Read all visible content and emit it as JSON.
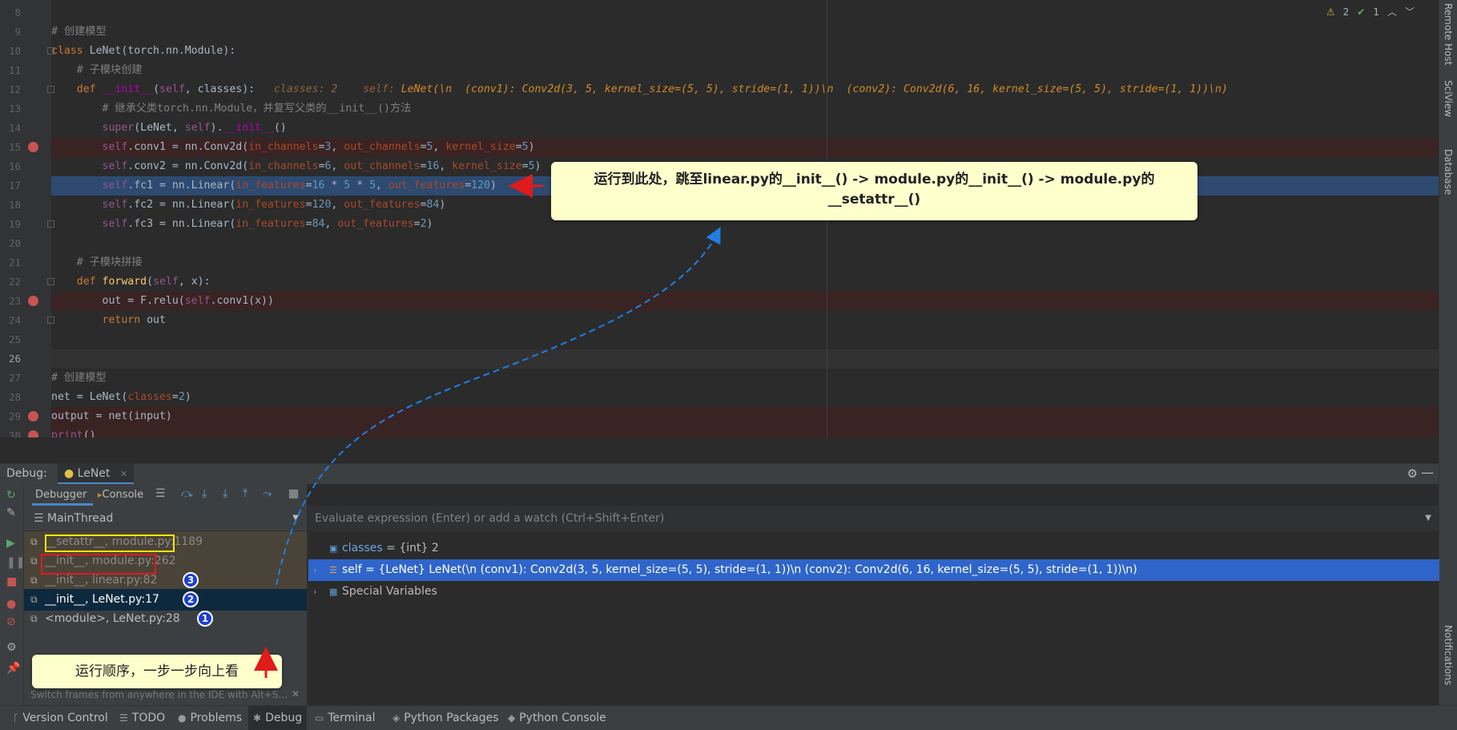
{
  "editor": {
    "lines": [
      {
        "n": "8",
        "parts": []
      },
      {
        "n": "9",
        "parts": [
          {
            "c": "cm",
            "t": "# 创建模型"
          }
        ]
      },
      {
        "n": "10",
        "parts": [
          {
            "c": "kw",
            "t": "class "
          },
          {
            "c": "",
            "t": "LeNet(torch.nn.Module):"
          }
        ]
      },
      {
        "n": "11",
        "parts": [
          {
            "c": "cm",
            "t": "    # 子模块创建"
          }
        ]
      },
      {
        "n": "12",
        "parts": [
          {
            "c": "kw",
            "t": "    def "
          },
          {
            "c": "mag",
            "t": "__init__"
          },
          {
            "c": "",
            "t": "("
          },
          {
            "c": "self",
            "t": "self"
          },
          {
            "c": "",
            "t": ", classes):   "
          },
          {
            "c": "dbg",
            "t": "classes: 2    self: "
          },
          {
            "c": "dbgv",
            "t": "LeNet(\\n  (conv1): Conv2d(3, 5, kernel_size=(5, 5), stride=(1, 1))\\n  (conv2): Conv2d(6, 16, kernel_size=(5, 5), stride=(1, 1))\\n)"
          }
        ]
      },
      {
        "n": "13",
        "parts": [
          {
            "c": "cm",
            "t": "        # 继承父类torch.nn.Module，并复写父类的__init__()方法"
          }
        ]
      },
      {
        "n": "14",
        "parts": [
          {
            "c": "self",
            "t": "        super"
          },
          {
            "c": "",
            "t": "(LeNet, "
          },
          {
            "c": "self",
            "t": "self"
          },
          {
            "c": "",
            "t": ")."
          },
          {
            "c": "mag",
            "t": "__init__"
          },
          {
            "c": "",
            "t": "()"
          }
        ]
      },
      {
        "n": "15",
        "parts": [
          {
            "c": "self",
            "t": "        self"
          },
          {
            "c": "",
            "t": ".conv1 = nn.Conv2d("
          },
          {
            "c": "prm",
            "t": "in_channels"
          },
          {
            "c": "",
            "t": "="
          },
          {
            "c": "num",
            "t": "3"
          },
          {
            "c": "",
            "t": ", "
          },
          {
            "c": "prm",
            "t": "out_channels"
          },
          {
            "c": "",
            "t": "="
          },
          {
            "c": "num",
            "t": "5"
          },
          {
            "c": "",
            "t": ", "
          },
          {
            "c": "prm",
            "t": "kernel_size"
          },
          {
            "c": "",
            "t": "="
          },
          {
            "c": "num",
            "t": "5"
          },
          {
            "c": "",
            "t": ")"
          }
        ]
      },
      {
        "n": "16",
        "parts": [
          {
            "c": "self",
            "t": "        self"
          },
          {
            "c": "",
            "t": ".conv2 = nn.Conv2d("
          },
          {
            "c": "prm",
            "t": "in_channels"
          },
          {
            "c": "",
            "t": "="
          },
          {
            "c": "num",
            "t": "6"
          },
          {
            "c": "",
            "t": ", "
          },
          {
            "c": "prm",
            "t": "out_channels"
          },
          {
            "c": "",
            "t": "="
          },
          {
            "c": "num",
            "t": "16"
          },
          {
            "c": "",
            "t": ", "
          },
          {
            "c": "prm",
            "t": "kernel_size"
          },
          {
            "c": "",
            "t": "="
          },
          {
            "c": "num",
            "t": "5"
          },
          {
            "c": "",
            "t": ")"
          }
        ]
      },
      {
        "n": "17",
        "parts": [
          {
            "c": "self",
            "t": "        self"
          },
          {
            "c": "",
            "t": ".fc1 = nn.Linear("
          },
          {
            "c": "prm",
            "t": "in_features"
          },
          {
            "c": "",
            "t": "="
          },
          {
            "c": "num",
            "t": "16"
          },
          {
            "c": "",
            "t": " * "
          },
          {
            "c": "num",
            "t": "5"
          },
          {
            "c": "",
            "t": " * "
          },
          {
            "c": "num",
            "t": "5"
          },
          {
            "c": "",
            "t": ", "
          },
          {
            "c": "prm",
            "t": "out_features"
          },
          {
            "c": "",
            "t": "="
          },
          {
            "c": "num",
            "t": "120"
          },
          {
            "c": "",
            "t": ")"
          }
        ]
      },
      {
        "n": "18",
        "parts": [
          {
            "c": "self",
            "t": "        self"
          },
          {
            "c": "",
            "t": ".fc2 = nn.Linear("
          },
          {
            "c": "prm",
            "t": "in_features"
          },
          {
            "c": "",
            "t": "="
          },
          {
            "c": "num",
            "t": "120"
          },
          {
            "c": "",
            "t": ", "
          },
          {
            "c": "prm",
            "t": "out_features"
          },
          {
            "c": "",
            "t": "="
          },
          {
            "c": "num",
            "t": "84"
          },
          {
            "c": "",
            "t": ")"
          }
        ]
      },
      {
        "n": "19",
        "parts": [
          {
            "c": "self",
            "t": "        self"
          },
          {
            "c": "",
            "t": ".fc3 = nn.Linear("
          },
          {
            "c": "prm",
            "t": "in_features"
          },
          {
            "c": "",
            "t": "="
          },
          {
            "c": "num",
            "t": "84"
          },
          {
            "c": "",
            "t": ", "
          },
          {
            "c": "prm",
            "t": "out_features"
          },
          {
            "c": "",
            "t": "="
          },
          {
            "c": "num",
            "t": "2"
          },
          {
            "c": "",
            "t": ")"
          }
        ]
      },
      {
        "n": "20",
        "parts": []
      },
      {
        "n": "21",
        "parts": [
          {
            "c": "cm",
            "t": "    # 子模块拼接"
          }
        ]
      },
      {
        "n": "22",
        "parts": [
          {
            "c": "kw",
            "t": "    def "
          },
          {
            "c": "fn",
            "t": "forward"
          },
          {
            "c": "",
            "t": "("
          },
          {
            "c": "self",
            "t": "self"
          },
          {
            "c": "",
            "t": ", x):"
          }
        ]
      },
      {
        "n": "23",
        "parts": [
          {
            "c": "",
            "t": "        out = F.relu("
          },
          {
            "c": "self",
            "t": "self"
          },
          {
            "c": "",
            "t": ".conv1(x))"
          }
        ]
      },
      {
        "n": "24",
        "parts": [
          {
            "c": "kw",
            "t": "        return "
          },
          {
            "c": "",
            "t": "out"
          }
        ]
      },
      {
        "n": "25",
        "parts": []
      },
      {
        "n": "26",
        "parts": []
      },
      {
        "n": "27",
        "parts": [
          {
            "c": "cm",
            "t": "# 创建模型"
          }
        ]
      },
      {
        "n": "28",
        "parts": [
          {
            "c": "",
            "t": "net = LeNet("
          },
          {
            "c": "prm",
            "t": "classes"
          },
          {
            "c": "",
            "t": "="
          },
          {
            "c": "num",
            "t": "2"
          },
          {
            "c": "",
            "t": ")"
          }
        ]
      },
      {
        "n": "29",
        "parts": [
          {
            "c": "",
            "t": "output = net(input)"
          }
        ]
      },
      {
        "n": "30",
        "parts": [
          {
            "c": "self",
            "t": "print"
          },
          {
            "c": "",
            "t": "()"
          }
        ]
      }
    ],
    "inspections": {
      "warnings": "2",
      "ok": "1"
    }
  },
  "callouts": {
    "step_note": "运行到此处，跳至linear.py的__init__() -> module.py的__init__() -> module.py的__setattr__()",
    "order_note": "运行顺序，一步一步向上看"
  },
  "right_strip": {
    "tabs": [
      "Remote Host",
      "SciView",
      "Database",
      "Notifications"
    ]
  },
  "debug": {
    "label": "Debug:",
    "run_tab": "LeNet",
    "subtabs": {
      "debugger": "Debugger",
      "console": "Console"
    },
    "thread": "MainThread",
    "frames": [
      {
        "text": "__setattr__, module.py:1189",
        "kind": "lib"
      },
      {
        "text": "__init__, module.py:262",
        "kind": "lib"
      },
      {
        "text": "__init__, linear.py:82",
        "kind": "lib",
        "badge": "3"
      },
      {
        "text": "__init__, LeNet.py:17",
        "kind": "sel",
        "badge": "2"
      },
      {
        "text": "<module>, LeNet.py:28",
        "kind": "norm",
        "badge": "1"
      }
    ],
    "hint": "Switch frames from anywhere in the IDE with Alt+S...",
    "eval_placeholder": "Evaluate expression (Enter) or add a watch (Ctrl+Shift+Enter)",
    "variables": [
      {
        "name": "classes",
        "value": "{int} 2",
        "icon": "01"
      },
      {
        "name": "self",
        "value": "{LeNet} LeNet(\\n  (conv1): Conv2d(3, 5, kernel_size=(5, 5), stride=(1, 1))\\n  (conv2): Conv2d(6, 16, kernel_size=(5, 5), stride=(1, 1))\\n)"
      },
      {
        "name": "Special Variables",
        "value": ""
      }
    ]
  },
  "statusbar": {
    "items": [
      "Version Control",
      "TODO",
      "Problems",
      "Debug",
      "Terminal",
      "Python Packages",
      "Python Console"
    ]
  },
  "colors": {
    "breakpoint": "#c75450",
    "current_line": "#2d4a71",
    "callout_bg": "#ffffcc",
    "badge": "#1a3fd6",
    "arrow_blue": "#1e7ee6",
    "arrow_red": "#e01b1b"
  }
}
